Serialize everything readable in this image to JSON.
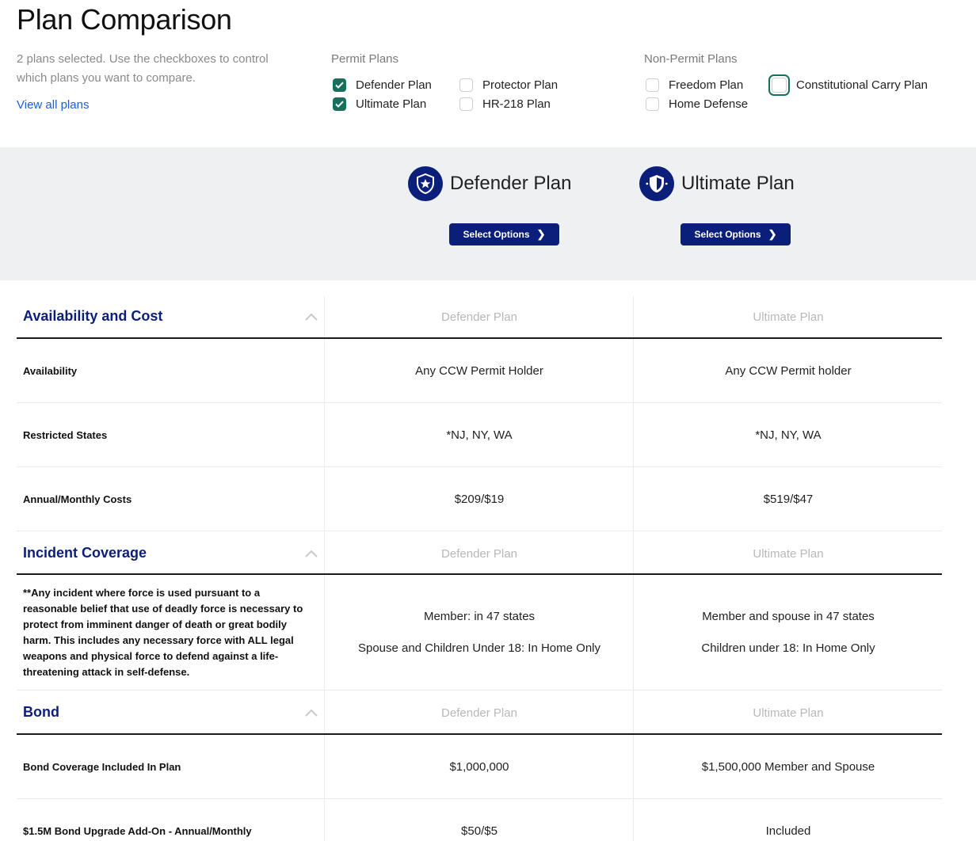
{
  "header": {
    "title": "Plan Comparison",
    "intro": "2 plans selected. Use the checkboxes to control which plans you want to compare.",
    "view_all": "View all plans"
  },
  "filters": {
    "permit_label": "Permit Plans",
    "nonpermit_label": "Non-Permit Plans",
    "permit_options": [
      {
        "label": "Defender Plan",
        "checked": true
      },
      {
        "label": "Protector Plan",
        "checked": false
      },
      {
        "label": "Ultimate Plan",
        "checked": true
      },
      {
        "label": "HR-218 Plan",
        "checked": false
      }
    ],
    "nonpermit_options": [
      {
        "label": "Freedom Plan",
        "checked": false
      },
      {
        "label": "Constitutional Carry Plan",
        "checked": false
      },
      {
        "label": "Home Defense",
        "checked": false
      }
    ]
  },
  "plans": [
    {
      "name": "Defender Plan",
      "button": "Select Options",
      "icon": "shield-star-icon"
    },
    {
      "name": "Ultimate Plan",
      "button": "Select Options",
      "icon": "shield-icon"
    }
  ],
  "sections": [
    {
      "title": "Availability and Cost",
      "col1": "Defender Plan",
      "col2": "Ultimate Plan",
      "rows": [
        {
          "label": "Availability",
          "v1": "Any CCW Permit Holder",
          "v2": "Any CCW Permit holder"
        },
        {
          "label": "Restricted States",
          "v1": "*NJ, NY, WA",
          "v2": "*NJ, NY, WA"
        },
        {
          "label": "Annual/Monthly Costs",
          "v1": "$209/$19",
          "v2": "$519/$47"
        }
      ]
    },
    {
      "title": "Incident Coverage",
      "col1": "Defender Plan",
      "col2": "Ultimate Plan",
      "rows": [
        {
          "label": "**Any incident where force is used pursuant to a reasonable belief that use of deadly force is necessary to protect from imminent danger of death or great bodily harm. This includes any necessary force with ALL legal weapons and physical force to defend against a life-threatening attack in self-defense.",
          "v1a": "Member: in 47 states",
          "v1b": "Spouse and Children Under 18: In Home Only",
          "v2a": "Member and spouse in 47 states",
          "v2b": "Children under 18: In Home Only"
        }
      ]
    },
    {
      "title": "Bond",
      "col1": "Defender Plan",
      "col2": "Ultimate Plan",
      "rows": [
        {
          "label": "Bond Coverage Included In Plan",
          "v1": "$1,000,000",
          "v2": "$1,500,000 Member and Spouse"
        },
        {
          "label": "$1.5M Bond Upgrade Add-On - Annual/Monthly",
          "v1": "$50/$5",
          "v2": "Included"
        }
      ]
    }
  ],
  "colors": {
    "navy": "#0b1f7a",
    "green": "#17705a",
    "band": "#eef0f2"
  }
}
